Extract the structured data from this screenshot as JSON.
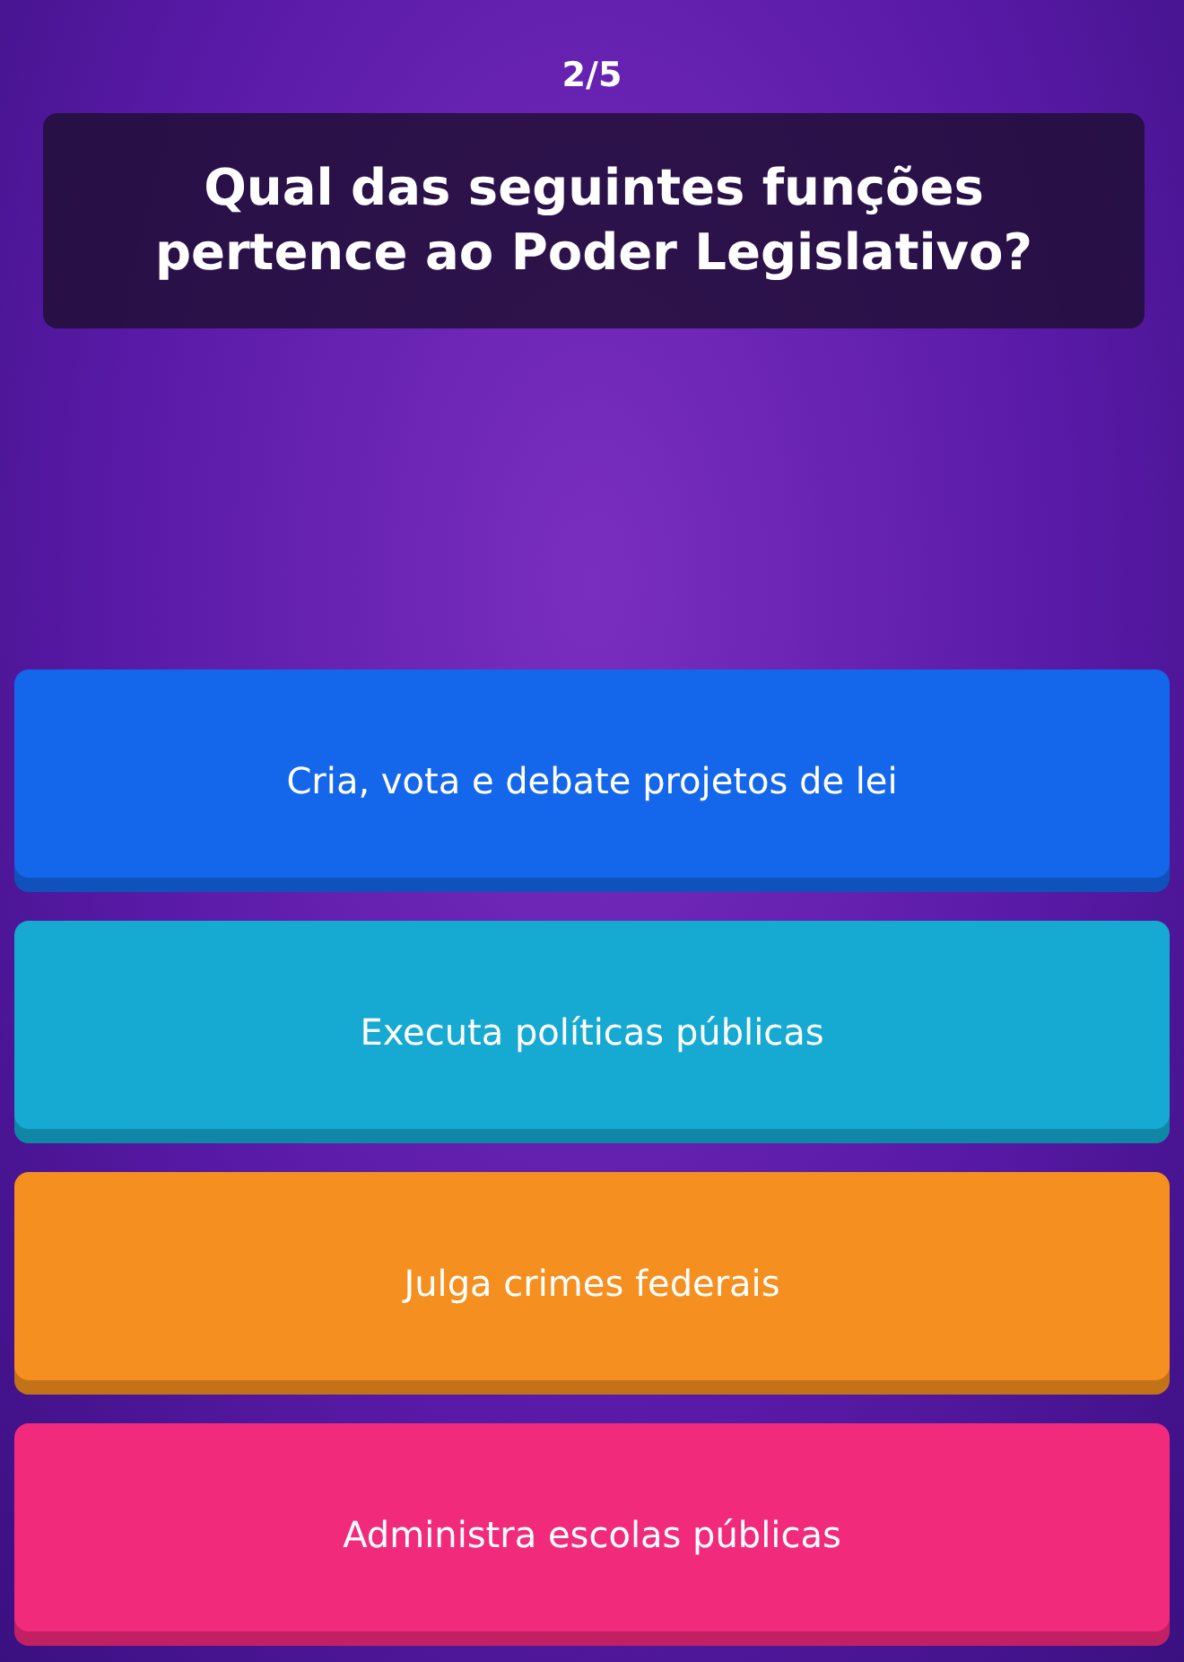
{
  "counter": "2/5",
  "question": "Qual das seguintes funções pertence ao Poder Legislativo?",
  "answers": [
    {
      "text": "Cria, vota e debate projetos de lei",
      "color": "#1467ea"
    },
    {
      "text": "Executa políticas públicas",
      "color": "#16a9d2"
    },
    {
      "text": "Julga crimes federais",
      "color": "#f58f1f"
    },
    {
      "text": "Administra escolas públicas",
      "color": "#f22a7c"
    }
  ]
}
